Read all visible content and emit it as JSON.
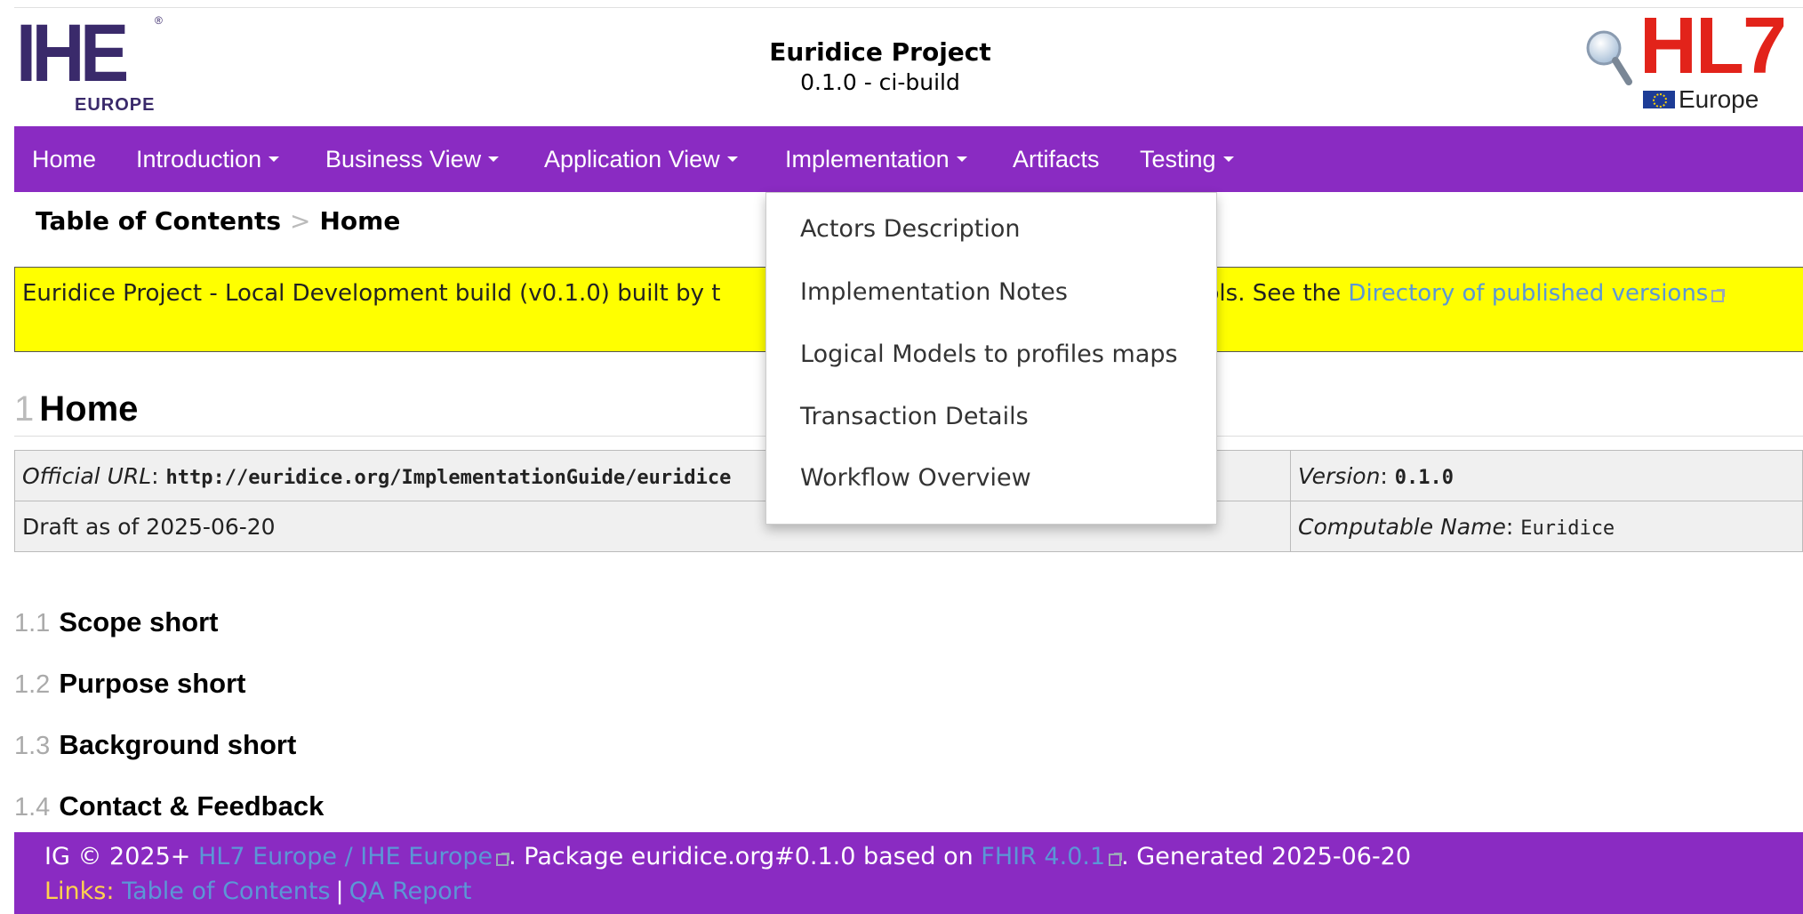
{
  "header": {
    "ihe_logo": {
      "mark": "IHE",
      "sub": "EUROPE",
      "reg": "®"
    },
    "project_title": "Euridice Project",
    "project_version": "0.1.0 - ci-build",
    "hl7_logo": {
      "mark": "HL7",
      "sub": "Europe"
    },
    "search_icon": "magnifier-icon"
  },
  "nav": {
    "items": [
      {
        "label": "Home",
        "has_caret": false
      },
      {
        "label": "Introduction",
        "has_caret": true
      },
      {
        "label": "Business View",
        "has_caret": true
      },
      {
        "label": "Application View",
        "has_caret": true
      },
      {
        "label": "Implementation",
        "has_caret": true
      },
      {
        "label": "Artifacts",
        "has_caret": false
      },
      {
        "label": "Testing",
        "has_caret": true
      }
    ],
    "background": "#8a2bc2"
  },
  "breadcrumb": {
    "root": "Table of Contents",
    "separator": ">",
    "current": "Home"
  },
  "banner": {
    "text_before": "Euridice Project - Local Development build (v0.1.0) built by t",
    "text_after": "uild Tools. See the ",
    "link_text_1": "Directory of published",
    "link_text_2": "versions",
    "background": "#ffff00"
  },
  "heading": {
    "number": "1",
    "title": "Home"
  },
  "info_table": {
    "official_url_label": "Official URL",
    "official_url_value": "http://euridice.org/ImplementationGuide/euridice",
    "version_label": "Version",
    "version_value": "0.1.0",
    "draft_text": "Draft as of 2025-06-20",
    "computable_label": "Computable Name",
    "computable_value": "Euridice"
  },
  "sections": [
    {
      "number": "1.1",
      "title": "Scope short"
    },
    {
      "number": "1.2",
      "title": "Purpose short"
    },
    {
      "number": "1.3",
      "title": "Background short"
    },
    {
      "number": "1.4",
      "title": "Contact & Feedback"
    }
  ],
  "dropdown": {
    "items": [
      "Actors Description",
      "Implementation Notes",
      "Logical Models to profiles maps",
      "Transaction Details",
      "Workflow Overview"
    ]
  },
  "footer": {
    "prefix": "IG © 2025+ ",
    "org_link": "HL7 Europe / IHE Europe",
    "mid_text": ". Package euridice.org#0.1.0 based on ",
    "fhir_link": "FHIR 4.0.1",
    "end_text": ". Generated 2025-06-20",
    "links_label": "Links:",
    "toc_link": "Table of Contents",
    "pipe": "|",
    "qa_link": "QA Report"
  }
}
